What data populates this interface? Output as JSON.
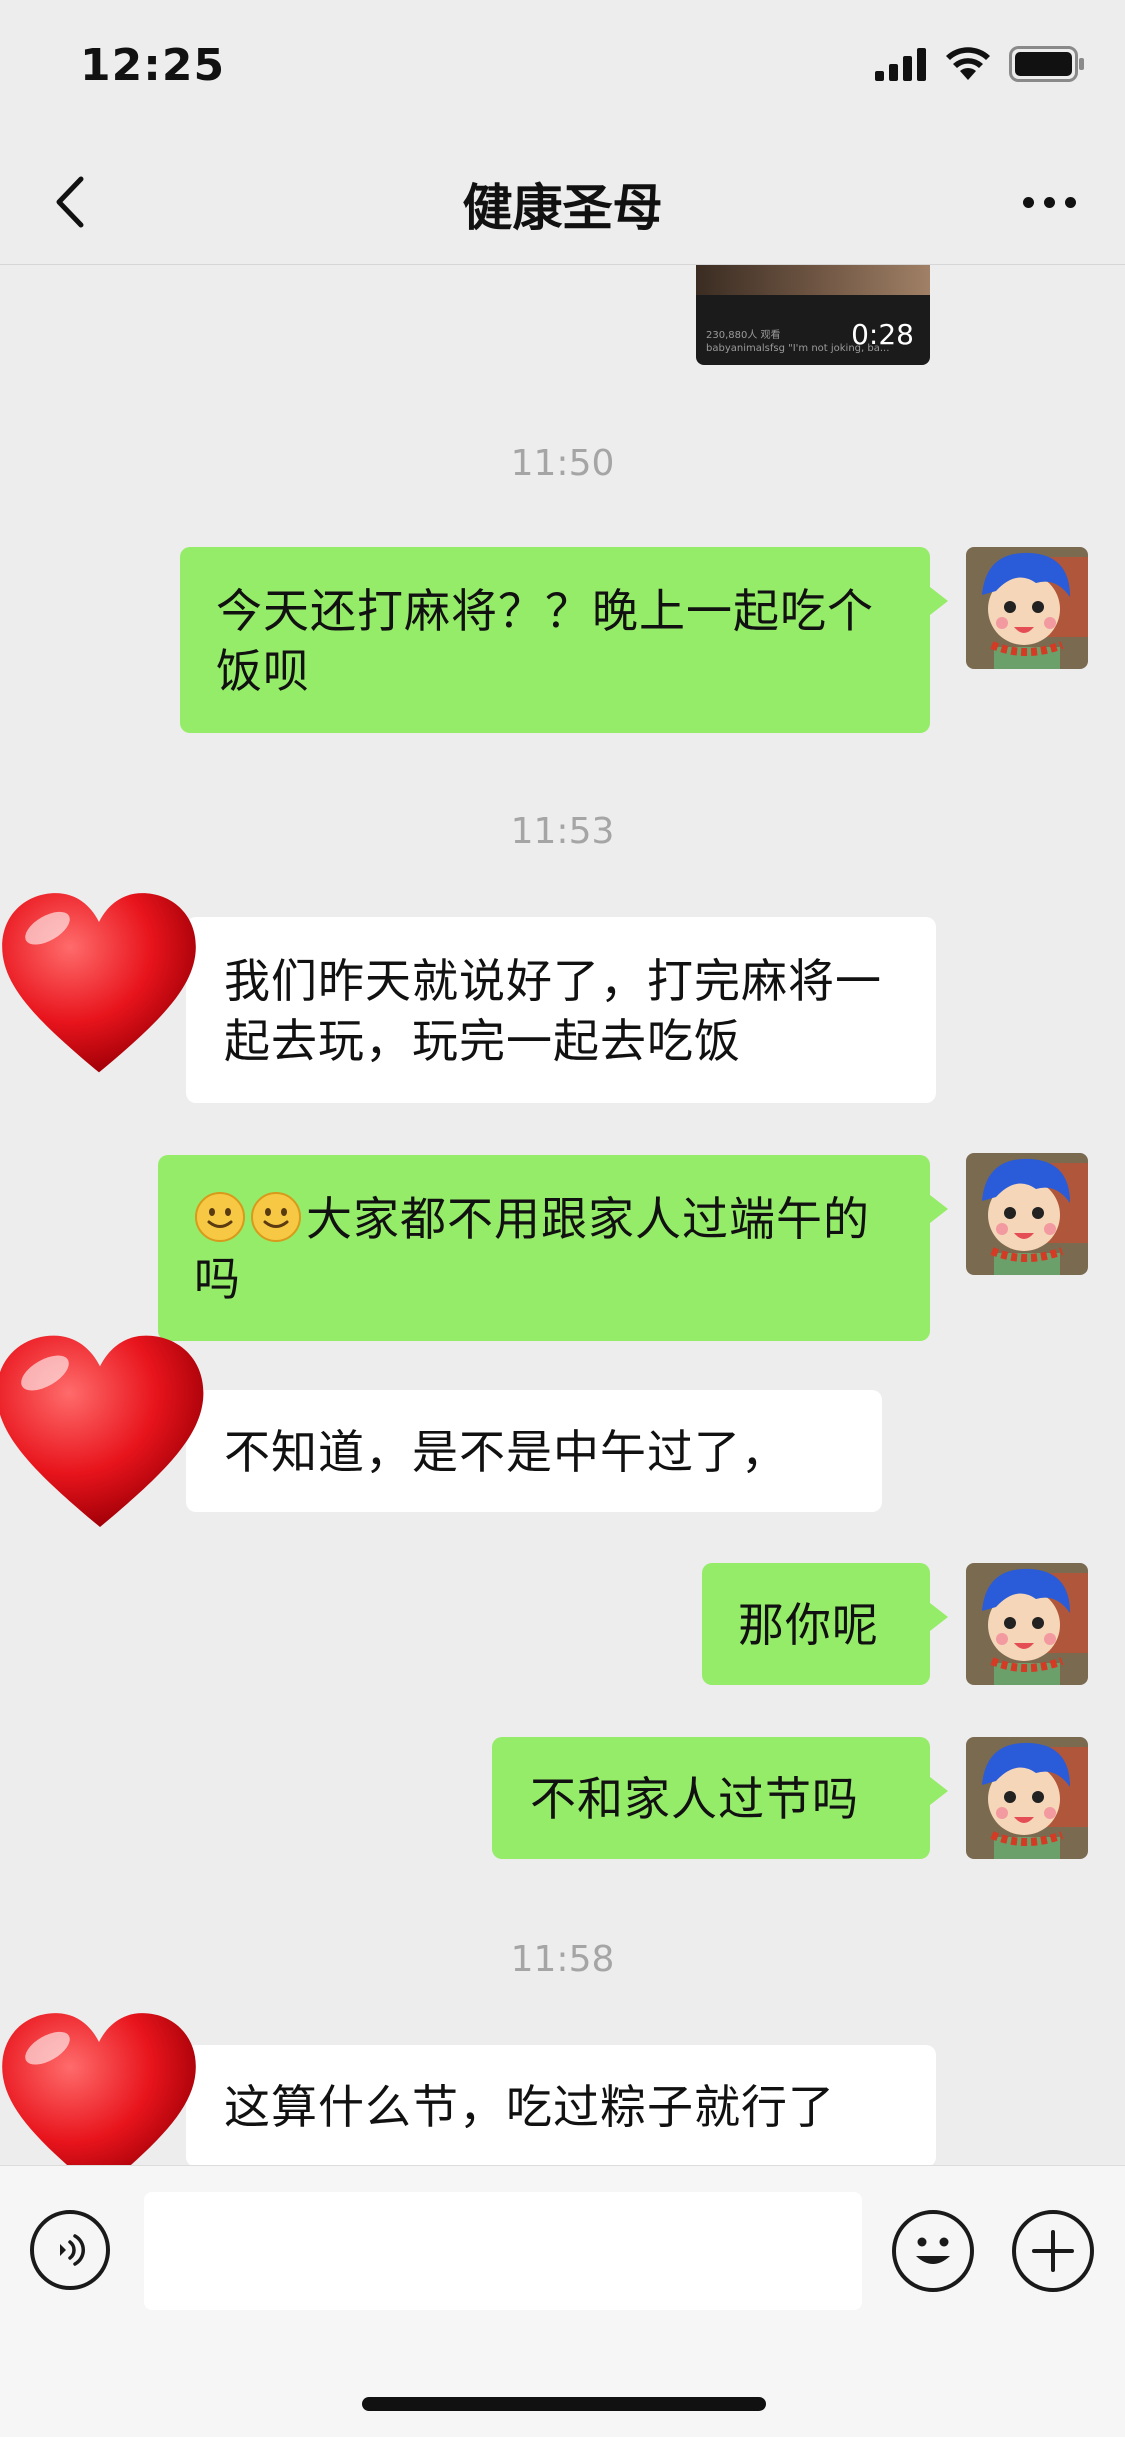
{
  "status_bar": {
    "time": "12:25"
  },
  "nav": {
    "title": "健康圣母"
  },
  "video": {
    "duration": "0:28",
    "caption_line1": "230,880人 观看",
    "caption_line2": "babyanimalsfsg \"I'm not joking, ba..."
  },
  "messages": {
    "t1": "11:50",
    "m1": "今天还打麻将？？晚上一起吃个饭呗",
    "t2": "11:53",
    "m2": "我们昨天就说好了，打完麻将一起去玩，玩完一起去吃饭",
    "m3": "大家都不用跟家人过端午的吗",
    "m4": "不知道，是不是中午过了，",
    "m5": "那你呢",
    "m6": "不和家人过节吗",
    "t3": "11:58",
    "m7": "这算什么节，吃过粽子就行了"
  },
  "colors": {
    "me_bubble": "#95ec69",
    "other_bubble": "#ffffff",
    "background": "#ededed"
  }
}
